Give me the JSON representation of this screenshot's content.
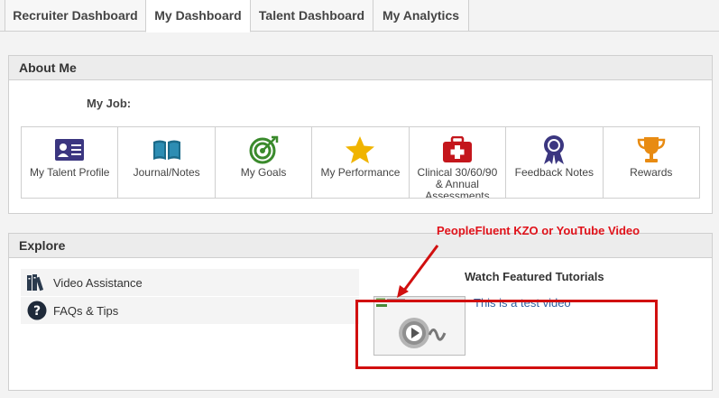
{
  "tabs": [
    {
      "label": "Recruiter Dashboard",
      "active": false
    },
    {
      "label": "My Dashboard",
      "active": true
    },
    {
      "label": "Talent Dashboard",
      "active": false
    },
    {
      "label": "My Analytics",
      "active": false
    }
  ],
  "about": {
    "title": "About Me",
    "my_job_label": "My Job:",
    "tiles": [
      {
        "label": "My Talent Profile",
        "icon": "id-card-icon"
      },
      {
        "label": "Journal/Notes",
        "icon": "open-book-icon"
      },
      {
        "label": "My Goals",
        "icon": "target-icon"
      },
      {
        "label": "My Performance",
        "icon": "star-icon"
      },
      {
        "label": "Clinical 30/60/90 & Annual Assessments",
        "icon": "first-aid-kit-icon"
      },
      {
        "label": "Feedback Notes",
        "icon": "ribbon-badge-icon"
      },
      {
        "label": "Rewards",
        "icon": "trophy-icon"
      }
    ]
  },
  "explore": {
    "title": "Explore",
    "items": [
      {
        "label": "Video Assistance",
        "icon": "books-icon"
      },
      {
        "label": "FAQs & Tips",
        "icon": "question-circle-icon"
      }
    ],
    "tutorials_title": "Watch Featured Tutorials",
    "video_link": "This is a test video"
  },
  "annotation": {
    "text": "PeopleFluent KZO or YouTube Video"
  },
  "colors": {
    "accent_blue": "#2f5e9e",
    "purple": "#3b3680",
    "teal": "#1c6b8a",
    "green": "#3a8a2c",
    "gold": "#f0b400",
    "red": "#c4161c",
    "orange": "#e88b12",
    "annotation_red": "#e0121a"
  }
}
